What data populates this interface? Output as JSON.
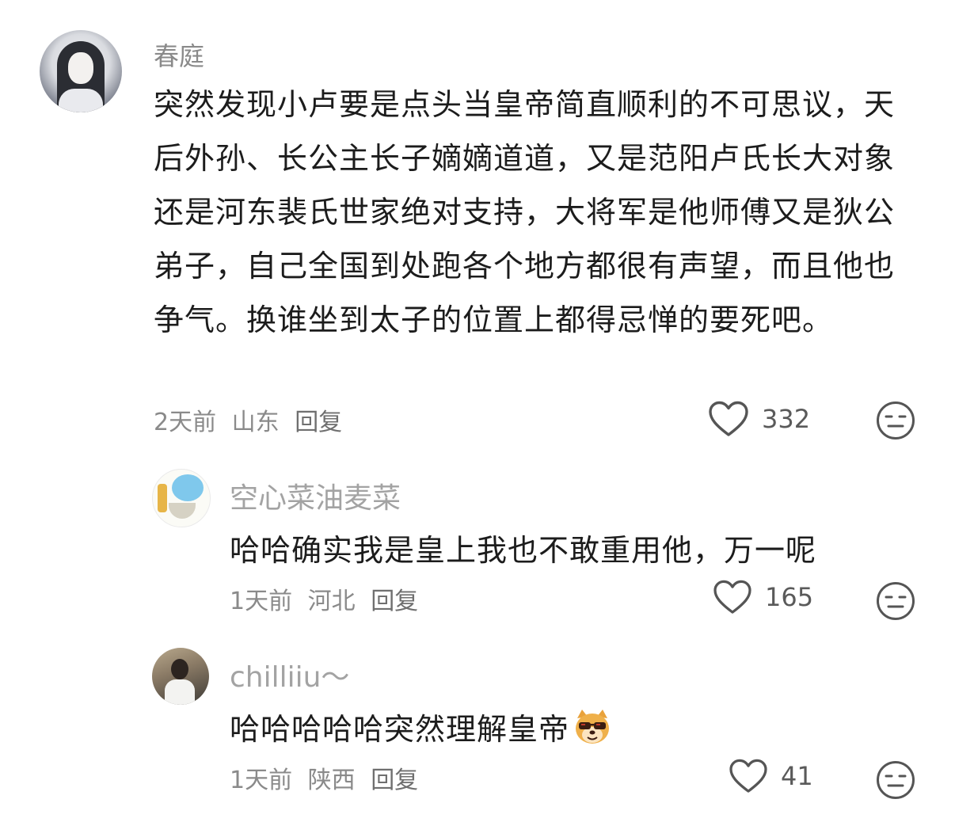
{
  "comments": [
    {
      "username": "春庭",
      "text": "突然发现小卢要是点头当皇帝简直顺利的不可思议，天后外孙、长公主长子嫡嫡道道，又是范阳卢氏长大对象还是河东裴氏世家绝对支持，大将军是他师傅又是狄公弟子，自己全国到处跑各个地方都很有声望，而且他也争气。换谁坐到太子的位置上都得忌惮的要死吧。",
      "time": "2天前",
      "location": "山东",
      "reply_label": "回复",
      "likes": "332"
    }
  ],
  "replies": [
    {
      "username": "空心菜油麦菜",
      "text": "哈哈确实我是皇上我也不敢重用他，万一呢",
      "time": "1天前",
      "location": "河北",
      "reply_label": "回复",
      "likes": "165"
    },
    {
      "username": "chilliiu～",
      "text": "哈哈哈哈哈突然理解皇帝",
      "sticker_icon": "dog-sunglasses-sticker-icon",
      "time": "1天前",
      "location": "陕西",
      "reply_label": "回复",
      "likes": "41"
    }
  ],
  "icons": {
    "like": "heart-outline-icon",
    "reaction": "expressionless-face-icon"
  },
  "colors": {
    "text": "#1c1c1c",
    "muted": "#8a8a8a",
    "icon_stroke": "#555555"
  }
}
